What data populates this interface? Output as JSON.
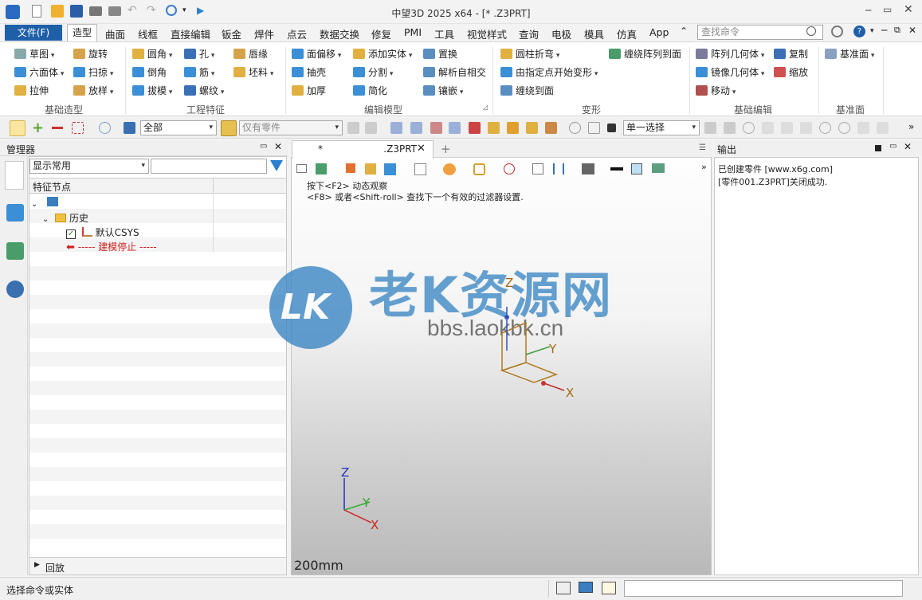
{
  "window": {
    "title": "中望3D 2025 x64 - [*                    .Z3PRT]"
  },
  "menubar": {
    "file": "文件(F)",
    "tabs": [
      "造型",
      "曲面",
      "线框",
      "直接编辑",
      "钣金",
      "焊件",
      "点云",
      "数据交换",
      "修复",
      "PMI",
      "工具",
      "视觉样式",
      "查询",
      "电极",
      "模具",
      "仿真",
      "App"
    ],
    "search_placeholder": "查找命令"
  },
  "ribbon": {
    "groups": [
      {
        "label": "基础造型",
        "items": [
          "草图",
          "旋转",
          "六面体",
          "扫掠",
          "拉伸",
          "放样"
        ]
      },
      {
        "label": "工程特征",
        "items": [
          "圆角",
          "孔",
          "唇缘",
          "倒角",
          "筋",
          "坯料",
          "拔模",
          "螺纹"
        ]
      },
      {
        "label": "编辑模型",
        "items": [
          "面偏移",
          "添加实体",
          "置换",
          "抽壳",
          "分割",
          "解析自相交",
          "加厚",
          "简化",
          "镶嵌"
        ]
      },
      {
        "label": "变形",
        "items": [
          "圆柱折弯",
          "缠绕阵列到面",
          "由指定点开始变形",
          "缠绕到面"
        ]
      },
      {
        "label": "基础编辑",
        "items": [
          "阵列几何体",
          "复制",
          "镜像几何体",
          "缩放",
          "移动"
        ]
      },
      {
        "label": "基准面",
        "items": [
          "基准面"
        ]
      }
    ]
  },
  "toolbar": {
    "filter_value": "全部",
    "part_filter": "仅有零件",
    "select_mode": "单一选择"
  },
  "manager": {
    "title": "管理器",
    "display_mode": "显示常用",
    "column": "特征节点",
    "tree": {
      "history": "历史",
      "csys": "默认CSYS",
      "stop": "----- 建模停止 -----"
    },
    "rollback": "回放"
  },
  "viewport": {
    "tab_label": "*                    .Z3PRT",
    "hint_line1": "按下<F2> 动态观察",
    "hint_line2": "<F8> 或者<Shift-roll> 查找下一个有效的过滤器设置.",
    "scale": "200mm",
    "axes": {
      "x": "X",
      "y": "Y",
      "z": "Z"
    }
  },
  "watermark": {
    "logo": "LK",
    "title": "老K资源网",
    "url": "bbs.laokbk.cn"
  },
  "output": {
    "title": "输出",
    "lines": [
      "已创建零件 [www.x6g.com]",
      "[零件001.Z3PRT]关闭成功."
    ]
  },
  "status": {
    "text": "选择命令或实体"
  }
}
